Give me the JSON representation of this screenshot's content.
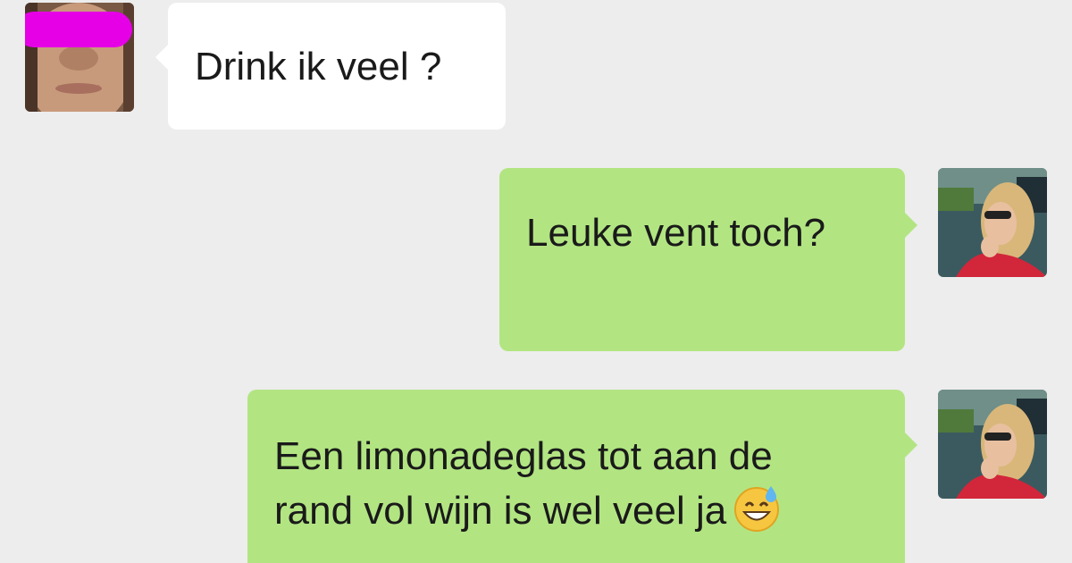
{
  "messages": [
    {
      "sender": "contact",
      "text": "Drink ik veel ?"
    },
    {
      "sender": "self",
      "text": "Leuke vent toch?"
    },
    {
      "sender": "self",
      "line1": "Een limonadeglas tot aan de",
      "line2": "rand vol wijn is wel veel ja",
      "emoji": "grinning-face-with-sweat-emoji"
    }
  ],
  "avatars": {
    "contact": {
      "icon": "contact-face-photo-with-magenta-redaction"
    },
    "self": {
      "icon": "woman-with-sunglasses-photo"
    }
  },
  "colors": {
    "background": "#ededed",
    "received_bubble": "#ffffff",
    "sent_bubble": "#b2e582",
    "redaction": "#e600e6"
  }
}
